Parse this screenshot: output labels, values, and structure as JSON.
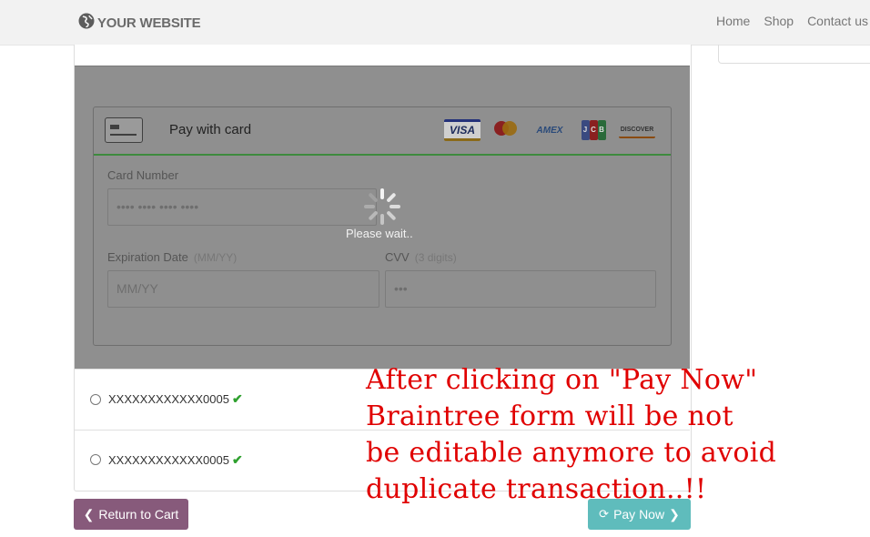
{
  "header": {
    "brand": "YOUR WEBSITE",
    "nav": [
      "Home",
      "Shop",
      "Contact us"
    ]
  },
  "payment_form": {
    "title": "Pay with card",
    "card_brands": [
      "VISA",
      "MasterCard",
      "AMEX",
      "JCB",
      "DISCOVER"
    ],
    "card_number": {
      "label": "Card Number",
      "placeholder": "•••• •••• •••• ••••"
    },
    "expiration": {
      "label": "Expiration Date",
      "hint": "(MM/YY)",
      "placeholder": "MM/YY"
    },
    "cvv": {
      "label": "CVV",
      "hint": "(3 digits)",
      "placeholder": "•••"
    },
    "loading_text": "Please wait.."
  },
  "saved_cards": [
    {
      "label": "XXXXXXXXXXXX0005",
      "verified": true
    },
    {
      "label": "XXXXXXXXXXXX0005",
      "verified": true
    }
  ],
  "buttons": {
    "return": "Return to Cart",
    "pay": "Pay Now"
  },
  "annotation": [
    "After  clicking  on  \"Pay Now\"",
    "Braintree  form  will  be  not",
    "be  editable  anymore  to  avoid",
    "duplicate  transaction..!!"
  ],
  "colors": {
    "return_button": "#875a7b",
    "pay_button": "#5fbcbc",
    "annotation": "#e00000",
    "check": "#2ea02e"
  }
}
